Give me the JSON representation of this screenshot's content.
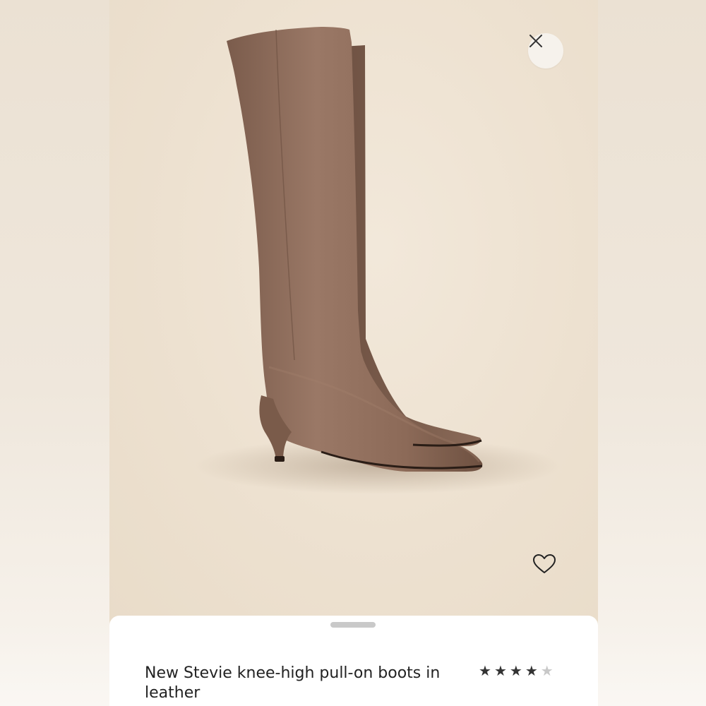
{
  "product": {
    "title": "New Stevie knee-high pull-on boots in leather",
    "rating": 4,
    "rating_max": 5,
    "image_alt": "brown-leather-knee-high-boots"
  },
  "controls": {
    "close_icon": "close-icon",
    "favorite_icon": "heart-outline-icon"
  },
  "colors": {
    "background": "#eee2d2",
    "boot": "#8a6a58",
    "sheet": "#ffffff",
    "text": "#222222"
  }
}
